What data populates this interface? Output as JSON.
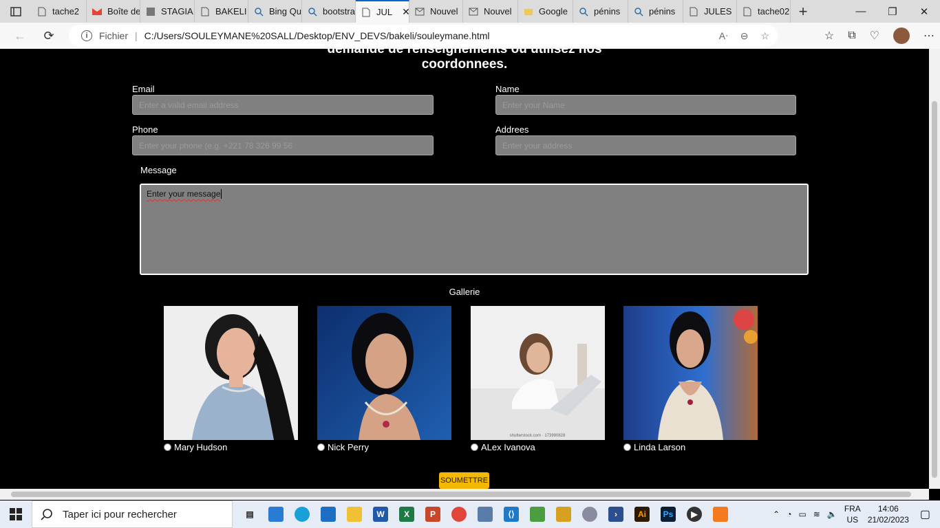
{
  "browser": {
    "tabs": [
      {
        "label": "tache2",
        "icon": "page-icon",
        "active": false
      },
      {
        "label": "Boîte de",
        "icon": "gmail-icon",
        "active": false
      },
      {
        "label": "STAGIAI",
        "icon": "image-icon",
        "active": false
      },
      {
        "label": "BAKELI",
        "icon": "page-icon",
        "active": false
      },
      {
        "label": "Bing Qu",
        "icon": "search-icon",
        "active": false
      },
      {
        "label": "bootstra",
        "icon": "search-icon",
        "active": false
      },
      {
        "label": "JUL",
        "icon": "page-icon",
        "active": true
      },
      {
        "label": "Nouvel",
        "icon": "mail-icon",
        "active": false
      },
      {
        "label": "Nouvel",
        "icon": "mail-icon",
        "active": false
      },
      {
        "label": "Google",
        "icon": "folder-icon",
        "active": false
      },
      {
        "label": "pénins",
        "icon": "search-icon",
        "active": false
      },
      {
        "label": "pénins",
        "icon": "search-icon",
        "active": false
      },
      {
        "label": "JULES",
        "icon": "page-icon",
        "active": false
      },
      {
        "label": "tache02",
        "icon": "page-icon",
        "active": false
      }
    ],
    "address": {
      "scheme_label": "Fichier",
      "url": "C:/Users/SOULEYMANE%20SALL/Desktop/ENV_DEVS/bakeli/souleymane.html"
    }
  },
  "page": {
    "intro_line1": "demande de renseignements ou utilisez nos",
    "intro_line2": "coordonnees.",
    "form": {
      "email_label": "Email",
      "email_placeholder": "Enter a valid email address",
      "name_label": "Name",
      "name_placeholder": "Enter your Name",
      "phone_label": "Phone",
      "phone_placeholder": "Enter your phone (e.g. +221 78 326 99 56",
      "address_label": "Addrees",
      "address_placeholder": "Enter your address",
      "message_label": "Message",
      "message_value": "Enter your message"
    },
    "gallery": {
      "title": "Gallerie",
      "items": [
        {
          "name": "Mary Hudson"
        },
        {
          "name": "Nick Perry"
        },
        {
          "name": "ALex Ivanova"
        },
        {
          "name": "Linda Larson"
        }
      ],
      "watermark": "shutterstock.com · 173990828"
    },
    "submit_label": "SOUMETTRE"
  },
  "taskbar": {
    "search_placeholder": "Taper ici pour rechercher",
    "lang_top": "FRA",
    "lang_bottom": "US",
    "time": "14:06",
    "date": "21/02/2023"
  },
  "colors": {
    "page_bg": "#000000",
    "field_bg": "#808080",
    "submit_bg": "#f5b800",
    "active_tab_accent": "#0a64c8"
  }
}
